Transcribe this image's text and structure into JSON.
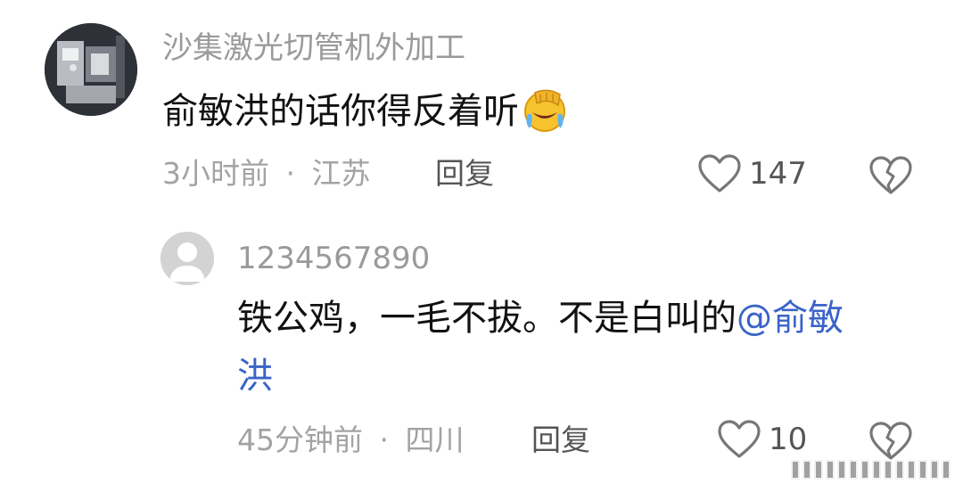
{
  "comments": [
    {
      "username": "沙集激光切管机外加工",
      "text": "俞敏洪的话你得反着听",
      "emoji": "facepalm-laughing-emoji",
      "time": "3小时前",
      "separator": "·",
      "location": "江苏",
      "reply_label": "回复",
      "likes": "147"
    },
    {
      "username": "1234567890",
      "text_line1": "铁公鸡，一毛不拔。不是白叫的",
      "mention_part1": "@俞敏",
      "mention_part2": "洪",
      "time": "45分钟前",
      "separator": "·",
      "location": "四川",
      "reply_label": "回复",
      "likes": "10"
    }
  ],
  "icons": {
    "like": "heart-outline-icon",
    "dislike": "broken-heart-icon"
  },
  "colors": {
    "mention": "#3a63c8",
    "meta": "#a3a3a3",
    "username": "#9a9a9a"
  }
}
